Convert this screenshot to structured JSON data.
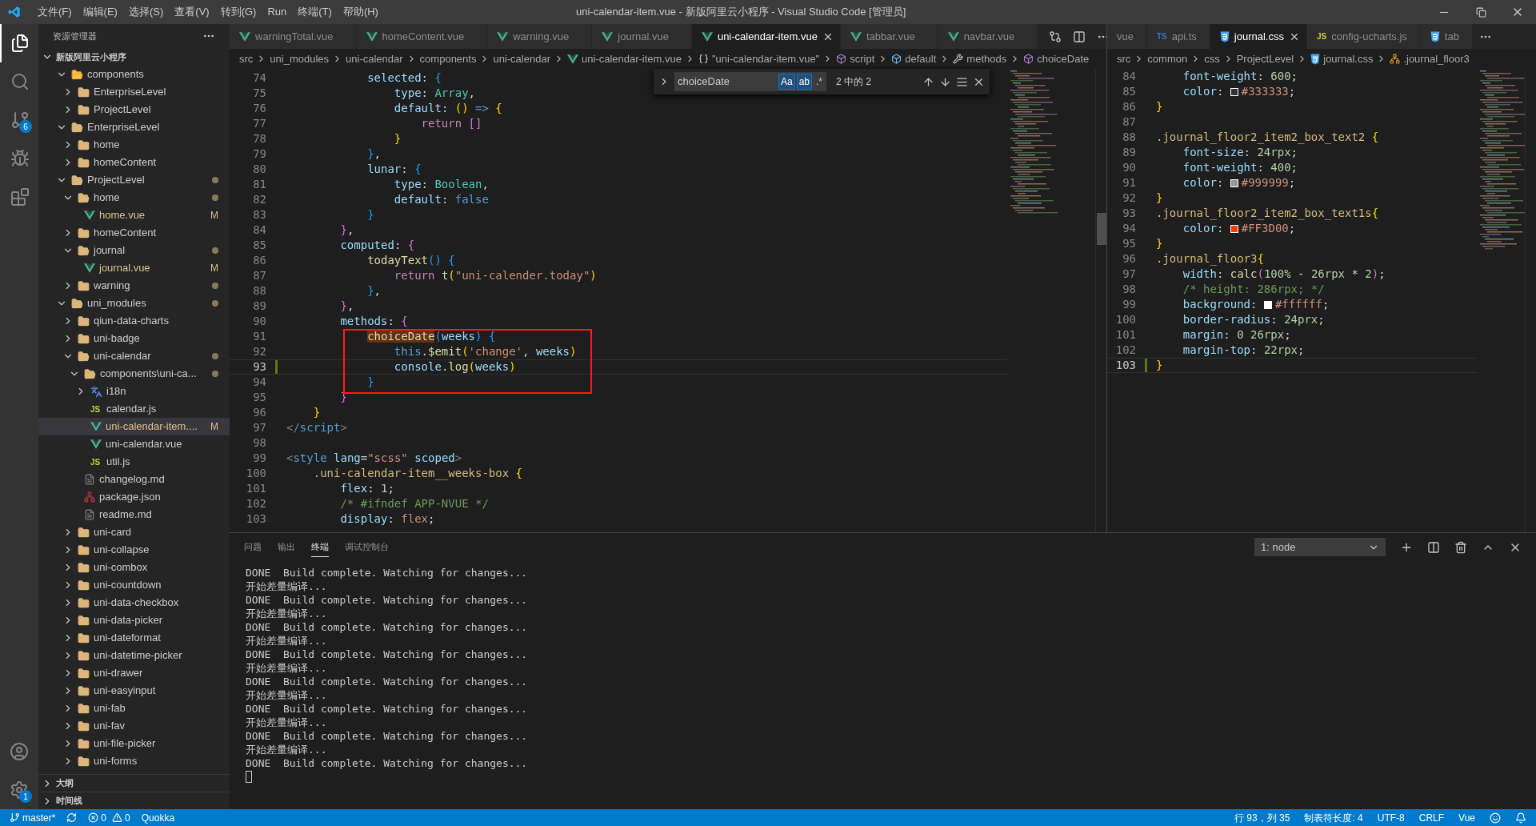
{
  "title_bar": {
    "menu": [
      "文件(F)",
      "编辑(E)",
      "选择(S)",
      "查看(V)",
      "转到(G)",
      "Run",
      "终端(T)",
      "帮助(H)"
    ],
    "title": "uni-calendar-item.vue - 新版阿里云小程序 - Visual Studio Code [管理员]"
  },
  "activity_bar": {
    "items": [
      {
        "kind": "explorer",
        "selected": true
      },
      {
        "kind": "search",
        "selected": false
      },
      {
        "kind": "scm",
        "selected": false,
        "badge": "6"
      },
      {
        "kind": "debug",
        "selected": false
      },
      {
        "kind": "extensions",
        "selected": false
      }
    ],
    "bottom": [
      {
        "kind": "account"
      },
      {
        "kind": "settings",
        "badge": "1"
      }
    ]
  },
  "sidebar": {
    "title": "资源管理器",
    "root": {
      "label": "新版阿里云小程序",
      "expanded": true,
      "children": [
        {
          "label": "components",
          "kind": "folder-special",
          "expanded": true,
          "selected": false,
          "dot": false,
          "children": [
            {
              "label": "EnterpriseLevel",
              "kind": "folder",
              "expanded": false,
              "selected": false,
              "dot": false
            },
            {
              "label": "ProjectLevel",
              "kind": "folder",
              "expanded": false,
              "selected": false,
              "dot": false
            }
          ]
        },
        {
          "label": "EnterpriseLevel",
          "kind": "folder",
          "expanded": true,
          "selected": false,
          "dot": false,
          "children": [
            {
              "label": "home",
              "kind": "folder",
              "expanded": false,
              "selected": false,
              "dot": false
            },
            {
              "label": "homeContent",
              "kind": "folder",
              "expanded": false,
              "selected": false,
              "dot": false
            }
          ]
        },
        {
          "label": "ProjectLevel",
          "kind": "folder",
          "expanded": true,
          "selected": false,
          "dot": true,
          "children": [
            {
              "label": "home",
              "kind": "folder",
              "expanded": true,
              "selected": false,
              "dot": true,
              "children": [
                {
                  "label": "home.vue",
                  "kind": "vue",
                  "selected": false,
                  "dot": false,
                  "badge": "M"
                }
              ]
            },
            {
              "label": "homeContent",
              "kind": "folder",
              "expanded": false,
              "selected": false,
              "dot": false
            },
            {
              "label": "journal",
              "kind": "folder",
              "expanded": true,
              "selected": false,
              "dot": true,
              "children": [
                {
                  "label": "journal.vue",
                  "kind": "vue",
                  "selected": false,
                  "dot": false,
                  "badge": "M"
                }
              ]
            },
            {
              "label": "warning",
              "kind": "folder",
              "expanded": false,
              "selected": false,
              "dot": true
            }
          ]
        },
        {
          "label": "uni_modules",
          "kind": "folder",
          "expanded": true,
          "selected": false,
          "dot": true,
          "children": [
            {
              "label": "qiun-data-charts",
              "kind": "folder",
              "expanded": false,
              "selected": false,
              "dot": false
            },
            {
              "label": "uni-badge",
              "kind": "folder",
              "expanded": false,
              "selected": false,
              "dot": false
            },
            {
              "label": "uni-calendar",
              "kind": "folder",
              "expanded": true,
              "selected": false,
              "dot": true,
              "children": [
                {
                  "label": "components\\uni-ca...",
                  "kind": "folder",
                  "expanded": true,
                  "selected": false,
                  "dot": true,
                  "children": [
                    {
                      "label": "i18n",
                      "kind": "folder-i18n",
                      "expanded": false,
                      "selected": false,
                      "dot": false
                    },
                    {
                      "label": "calendar.js",
                      "kind": "js",
                      "badge_icon": "JS",
                      "selected": false,
                      "dot": false
                    },
                    {
                      "label": "uni-calendar-item....",
                      "kind": "vue",
                      "selected": true,
                      "dot": false,
                      "badge": "M"
                    },
                    {
                      "label": "uni-calendar.vue",
                      "kind": "vue",
                      "selected": false,
                      "dot": false
                    },
                    {
                      "label": "util.js",
                      "kind": "js",
                      "badge_icon": "JS",
                      "selected": false,
                      "dot": false
                    }
                  ]
                },
                {
                  "label": "changelog.md",
                  "kind": "md",
                  "selected": false,
                  "dot": false
                },
                {
                  "label": "package.json",
                  "kind": "json",
                  "selected": false,
                  "dot": false
                },
                {
                  "label": "readme.md",
                  "kind": "md",
                  "selected": false,
                  "dot": false
                }
              ]
            },
            {
              "label": "uni-card",
              "kind": "folder",
              "expanded": false,
              "selected": false,
              "dot": false
            },
            {
              "label": "uni-collapse",
              "kind": "folder",
              "expanded": false,
              "selected": false,
              "dot": false
            },
            {
              "label": "uni-combox",
              "kind": "folder",
              "expanded": false,
              "selected": false,
              "dot": false
            },
            {
              "label": "uni-countdown",
              "kind": "folder",
              "expanded": false,
              "selected": false,
              "dot": false
            },
            {
              "label": "uni-data-checkbox",
              "kind": "folder",
              "expanded": false,
              "selected": false,
              "dot": false
            },
            {
              "label": "uni-data-picker",
              "kind": "folder",
              "expanded": false,
              "selected": false,
              "dot": false
            },
            {
              "label": "uni-dateformat",
              "kind": "folder",
              "expanded": false,
              "selected": false,
              "dot": false
            },
            {
              "label": "uni-datetime-picker",
              "kind": "folder",
              "expanded": false,
              "selected": false,
              "dot": false
            },
            {
              "label": "uni-drawer",
              "kind": "folder",
              "expanded": false,
              "selected": false,
              "dot": false
            },
            {
              "label": "uni-easyinput",
              "kind": "folder",
              "expanded": false,
              "selected": false,
              "dot": false
            },
            {
              "label": "uni-fab",
              "kind": "folder",
              "expanded": false,
              "selected": false,
              "dot": false
            },
            {
              "label": "uni-fav",
              "kind": "folder",
              "expanded": false,
              "selected": false,
              "dot": false
            },
            {
              "label": "uni-file-picker",
              "kind": "folder",
              "expanded": false,
              "selected": false,
              "dot": false
            },
            {
              "label": "uni-forms",
              "kind": "folder",
              "expanded": false,
              "selected": false,
              "dot": false
            }
          ]
        }
      ]
    },
    "sections": [
      {
        "label": "大纲",
        "expanded": false
      },
      {
        "label": "时间线",
        "expanded": false
      }
    ]
  },
  "left_editor": {
    "tabs": [
      {
        "label": "warningTotal.vue",
        "kind": "vue",
        "selected": false
      },
      {
        "label": "homeContent.vue",
        "kind": "vue",
        "selected": false
      },
      {
        "label": "warning.vue",
        "kind": "vue",
        "selected": false
      },
      {
        "label": "journal.vue",
        "kind": "vue",
        "selected": false
      },
      {
        "label": "uni-calendar-item.vue",
        "kind": "vue",
        "selected": true
      },
      {
        "label": "tabbar.vue",
        "kind": "vue",
        "selected": false
      },
      {
        "label": "navbar.vue",
        "kind": "vue",
        "selected": false
      }
    ],
    "breadcrumbs": [
      {
        "label": "src",
        "kind": "folder"
      },
      {
        "label": "uni_modules",
        "kind": "folder"
      },
      {
        "label": "uni-calendar",
        "kind": "folder"
      },
      {
        "label": "components",
        "kind": "folder"
      },
      {
        "label": "uni-calendar",
        "kind": "folder"
      },
      {
        "label": "uni-calendar-item.vue",
        "kind": "vue"
      },
      {
        "label": "\"uni-calendar-item.vue\"",
        "kind": "braces"
      },
      {
        "label": "script",
        "kind": "element"
      },
      {
        "label": "default",
        "kind": "field"
      },
      {
        "label": "methods",
        "kind": "wrench"
      },
      {
        "label": "choiceDate",
        "kind": "method"
      }
    ],
    "find": {
      "value": "choiceDate",
      "options": [
        {
          "label": "Aa",
          "on": true
        },
        {
          "label": "ab",
          "on": true
        },
        {
          "label": ".*",
          "on": false
        }
      ],
      "count": "2 中的 2"
    },
    "lines": [
      {
        "number": "74",
        "current": false,
        "tokens": [
          {
            "kind": "prop",
            "text": "            selected"
          },
          {
            "kind": "punc",
            "text": ": "
          },
          {
            "kind": "b3",
            "text": "{"
          }
        ]
      },
      {
        "number": "75",
        "current": false,
        "tokens": [
          {
            "kind": "prop",
            "text": "                type"
          },
          {
            "kind": "punc",
            "text": ": "
          },
          {
            "kind": "type",
            "text": "Array"
          },
          {
            "kind": "punc",
            "text": ","
          }
        ]
      },
      {
        "number": "76",
        "current": false,
        "tokens": [
          {
            "kind": "prop",
            "text": "                default"
          },
          {
            "kind": "punc",
            "text": ": "
          },
          {
            "kind": "b1",
            "text": "()"
          },
          {
            "kind": "kw",
            "text": " =>"
          },
          {
            "kind": "b1",
            "text": " {"
          }
        ]
      },
      {
        "number": "77",
        "current": false,
        "tokens": [
          {
            "kind": "ctrl",
            "text": "                    return"
          },
          {
            "kind": "b2",
            "text": " []"
          }
        ]
      },
      {
        "number": "78",
        "current": false,
        "tokens": [
          {
            "kind": "b1",
            "text": "                }"
          }
        ]
      },
      {
        "number": "79",
        "current": false,
        "tokens": [
          {
            "kind": "b3",
            "text": "            }"
          },
          {
            "kind": "punc",
            "text": ","
          }
        ]
      },
      {
        "number": "80",
        "current": false,
        "tokens": [
          {
            "kind": "prop",
            "text": "            lunar"
          },
          {
            "kind": "punc",
            "text": ": "
          },
          {
            "kind": "b3",
            "text": "{"
          }
        ]
      },
      {
        "number": "81",
        "current": false,
        "tokens": [
          {
            "kind": "prop",
            "text": "                type"
          },
          {
            "kind": "punc",
            "text": ": "
          },
          {
            "kind": "type",
            "text": "Boolean"
          },
          {
            "kind": "punc",
            "text": ","
          }
        ]
      },
      {
        "number": "82",
        "current": false,
        "tokens": [
          {
            "kind": "prop",
            "text": "                default"
          },
          {
            "kind": "punc",
            "text": ": "
          },
          {
            "kind": "kw",
            "text": "false"
          }
        ]
      },
      {
        "number": "83",
        "current": false,
        "tokens": [
          {
            "kind": "b3",
            "text": "            }"
          }
        ]
      },
      {
        "number": "84",
        "current": false,
        "tokens": [
          {
            "kind": "b2",
            "text": "        }"
          },
          {
            "kind": "punc",
            "text": ","
          }
        ]
      },
      {
        "number": "85",
        "current": false,
        "tokens": [
          {
            "kind": "prop",
            "text": "        computed"
          },
          {
            "kind": "punc",
            "text": ": "
          },
          {
            "kind": "b2",
            "text": "{"
          }
        ]
      },
      {
        "number": "86",
        "current": false,
        "tokens": [
          {
            "kind": "fn",
            "text": "            todayText"
          },
          {
            "kind": "b3",
            "text": "()"
          },
          {
            "kind": "b3",
            "text": " {"
          }
        ]
      },
      {
        "number": "87",
        "current": false,
        "tokens": [
          {
            "kind": "ctrl",
            "text": "                return"
          },
          {
            "kind": "fn",
            "text": " t"
          },
          {
            "kind": "b1",
            "text": "("
          },
          {
            "kind": "str",
            "text": "\"uni-calender.today\""
          },
          {
            "kind": "b1",
            "text": ")"
          }
        ]
      },
      {
        "number": "88",
        "current": false,
        "tokens": [
          {
            "kind": "b3",
            "text": "            }"
          },
          {
            "kind": "punc",
            "text": ","
          }
        ]
      },
      {
        "number": "89",
        "current": false,
        "tokens": [
          {
            "kind": "b2",
            "text": "        }"
          },
          {
            "kind": "punc",
            "text": ","
          }
        ]
      },
      {
        "number": "90",
        "current": false,
        "tokens": [
          {
            "kind": "prop",
            "text": "        methods"
          },
          {
            "kind": "punc",
            "text": ": "
          },
          {
            "kind": "b2",
            "text": "{"
          }
        ]
      },
      {
        "number": "91",
        "current": false,
        "tokens": [
          {
            "kind": "match",
            "text": "            choiceDate"
          },
          {
            "kind": "b3",
            "text": "("
          },
          {
            "kind": "var",
            "text": "weeks"
          },
          {
            "kind": "b3",
            "text": ")"
          },
          {
            "kind": "b3",
            "text": " {"
          }
        ]
      },
      {
        "number": "92",
        "current": false,
        "tokens": [
          {
            "kind": "kw",
            "text": "                this"
          },
          {
            "kind": "fn",
            "text": ".$emit"
          },
          {
            "kind": "b1",
            "text": "("
          },
          {
            "kind": "str",
            "text": "'change'"
          },
          {
            "kind": "punc",
            "text": ", "
          },
          {
            "kind": "var",
            "text": "weeks"
          },
          {
            "kind": "b1",
            "text": ")"
          }
        ]
      },
      {
        "number": "93",
        "current": true,
        "tokens": [
          {
            "kind": "var",
            "text": "                console"
          },
          {
            "kind": "punc",
            "text": "."
          },
          {
            "kind": "fn",
            "text": "log"
          },
          {
            "kind": "b1",
            "text": "("
          },
          {
            "kind": "var",
            "text": "weeks"
          },
          {
            "kind": "b1",
            "text": ")"
          }
        ]
      },
      {
        "number": "94",
        "current": false,
        "tokens": [
          {
            "kind": "b3",
            "text": "            }"
          }
        ]
      },
      {
        "number": "95",
        "current": false,
        "tokens": [
          {
            "kind": "b2",
            "text": "        }"
          }
        ]
      },
      {
        "number": "96",
        "current": false,
        "tokens": [
          {
            "kind": "b1",
            "text": "    }"
          }
        ]
      },
      {
        "number": "97",
        "current": false,
        "tokens": [
          {
            "kind": "tag",
            "text": "</"
          },
          {
            "kind": "tagname",
            "text": "script"
          },
          {
            "kind": "tag",
            "text": ">"
          }
        ]
      },
      {
        "number": "98",
        "current": false
      },
      {
        "number": "99",
        "current": false,
        "tokens": [
          {
            "kind": "tag",
            "text": "<"
          },
          {
            "kind": "tagname",
            "text": "style"
          },
          {
            "kind": "prop",
            "text": " lang"
          },
          {
            "kind": "punc",
            "text": "="
          },
          {
            "kind": "str",
            "text": "\"scss\""
          },
          {
            "kind": "prop",
            "text": " scoped"
          },
          {
            "kind": "tag",
            "text": ">"
          }
        ]
      },
      {
        "number": "100",
        "current": false,
        "tokens": [
          {
            "kind": "sel",
            "text": "    .uni-calendar-item__weeks-box"
          },
          {
            "kind": "b1",
            "text": " {"
          }
        ]
      },
      {
        "number": "101",
        "current": false,
        "tokens": [
          {
            "kind": "prop",
            "text": "        flex"
          },
          {
            "kind": "punc",
            "text": ": "
          },
          {
            "kind": "num",
            "text": "1"
          },
          {
            "kind": "punc",
            "text": ";"
          }
        ]
      },
      {
        "number": "102",
        "current": false,
        "tokens": [
          {
            "kind": "comment",
            "text": "        /* #ifndef APP-NVUE */"
          }
        ]
      },
      {
        "number": "103",
        "current": false,
        "tokens": [
          {
            "kind": "prop",
            "text": "        display"
          },
          {
            "kind": "punc",
            "text": ": "
          },
          {
            "kind": "str",
            "text": "flex"
          },
          {
            "kind": "punc",
            "text": ";"
          }
        ]
      }
    ]
  },
  "right_editor": {
    "tabs": [
      {
        "label": "vue",
        "kind": "plain",
        "selected": false
      },
      {
        "label": "api.ts",
        "kind": "ts",
        "badge": "TS",
        "selected": false
      },
      {
        "label": "journal.css",
        "kind": "css",
        "selected": true
      },
      {
        "label": "config-ucharts.js",
        "kind": "js",
        "badge": "JS",
        "selected": false
      },
      {
        "label": "tab",
        "kind": "css",
        "selected": false
      }
    ],
    "breadcrumbs": [
      {
        "label": "src",
        "kind": "folder"
      },
      {
        "label": "common",
        "kind": "folder"
      },
      {
        "label": "css",
        "kind": "folder"
      },
      {
        "label": "ProjectLevel",
        "kind": "folder"
      },
      {
        "label": "journal.css",
        "kind": "css"
      },
      {
        "label": ".journal_floor3",
        "kind": "class"
      }
    ],
    "lines": [
      {
        "number": "84",
        "current": false,
        "tokens": [
          {
            "kind": "prop",
            "text": "    font-weight"
          },
          {
            "kind": "punc",
            "text": ": "
          },
          {
            "kind": "num",
            "text": "600"
          },
          {
            "kind": "punc",
            "text": ";"
          }
        ]
      },
      {
        "number": "85",
        "current": false,
        "tokens": [
          {
            "kind": "prop",
            "text": "    color"
          },
          {
            "kind": "punc",
            "text": ": "
          },
          {
            "kind": "colorval",
            "text": "#333333",
            "color": "#333333"
          },
          {
            "kind": "punc",
            "text": ";"
          }
        ]
      },
      {
        "number": "86",
        "current": false,
        "tokens": [
          {
            "kind": "b1",
            "text": "}"
          }
        ]
      },
      {
        "number": "87",
        "current": false
      },
      {
        "number": "88",
        "current": false,
        "tokens": [
          {
            "kind": "sel",
            "text": ".journal_floor2_item2_box_text2"
          },
          {
            "kind": "b1",
            "text": " {"
          }
        ]
      },
      {
        "number": "89",
        "current": false,
        "tokens": [
          {
            "kind": "prop",
            "text": "    font-size"
          },
          {
            "kind": "punc",
            "text": ": "
          },
          {
            "kind": "num",
            "text": "24rpx"
          },
          {
            "kind": "punc",
            "text": ";"
          }
        ]
      },
      {
        "number": "90",
        "current": false,
        "tokens": [
          {
            "kind": "prop",
            "text": "    font-weight"
          },
          {
            "kind": "punc",
            "text": ": "
          },
          {
            "kind": "num",
            "text": "400"
          },
          {
            "kind": "punc",
            "text": ";"
          }
        ]
      },
      {
        "number": "91",
        "current": false,
        "tokens": [
          {
            "kind": "prop",
            "text": "    color"
          },
          {
            "kind": "punc",
            "text": ": "
          },
          {
            "kind": "colorval",
            "text": "#999999",
            "color": "#999999"
          },
          {
            "kind": "punc",
            "text": ";"
          }
        ]
      },
      {
        "number": "92",
        "current": false,
        "tokens": [
          {
            "kind": "b1",
            "text": "}"
          }
        ]
      },
      {
        "number": "93",
        "current": false,
        "tokens": [
          {
            "kind": "sel",
            "text": ".journal_floor2_item2_box_text1s"
          },
          {
            "kind": "b1",
            "text": "{"
          }
        ]
      },
      {
        "number": "94",
        "current": false,
        "tokens": [
          {
            "kind": "prop",
            "text": "    color"
          },
          {
            "kind": "punc",
            "text": ": "
          },
          {
            "kind": "colorval",
            "text": "#FF3D00",
            "color": "#ff3d00"
          },
          {
            "kind": "punc",
            "text": ";"
          }
        ]
      },
      {
        "number": "95",
        "current": false,
        "tokens": [
          {
            "kind": "b1",
            "text": "}"
          }
        ]
      },
      {
        "number": "96",
        "current": false,
        "tokens": [
          {
            "kind": "sel",
            "text": ".journal_floor3"
          },
          {
            "kind": "b1",
            "text": "{"
          }
        ]
      },
      {
        "number": "97",
        "current": false,
        "tokens": [
          {
            "kind": "prop",
            "text": "    width"
          },
          {
            "kind": "punc",
            "text": ": "
          },
          {
            "kind": "fn",
            "text": "calc"
          },
          {
            "kind": "b2",
            "text": "("
          },
          {
            "kind": "num",
            "text": "100%"
          },
          {
            "kind": "punc",
            "text": " - "
          },
          {
            "kind": "num",
            "text": "26rpx"
          },
          {
            "kind": "punc",
            "text": " * "
          },
          {
            "kind": "num",
            "text": "2"
          },
          {
            "kind": "b2",
            "text": ")"
          },
          {
            "kind": "punc",
            "text": ";"
          }
        ]
      },
      {
        "number": "98",
        "current": false,
        "tokens": [
          {
            "kind": "comment",
            "text": "    /* height: 286rpx; */"
          }
        ]
      },
      {
        "number": "99",
        "current": false,
        "tokens": [
          {
            "kind": "prop",
            "text": "    background"
          },
          {
            "kind": "punc",
            "text": ": "
          },
          {
            "kind": "colorval",
            "text": "#ffffff",
            "color": "#ffffff"
          },
          {
            "kind": "punc",
            "text": ";"
          }
        ]
      },
      {
        "number": "100",
        "current": false,
        "tokens": [
          {
            "kind": "prop",
            "text": "    border-radius"
          },
          {
            "kind": "punc",
            "text": ": "
          },
          {
            "kind": "num",
            "text": "24prx"
          },
          {
            "kind": "punc",
            "text": ";"
          }
        ]
      },
      {
        "number": "101",
        "current": false,
        "tokens": [
          {
            "kind": "prop",
            "text": "    margin"
          },
          {
            "kind": "punc",
            "text": ": "
          },
          {
            "kind": "num",
            "text": "0 26rpx"
          },
          {
            "kind": "punc",
            "text": ";"
          }
        ]
      },
      {
        "number": "102",
        "current": false,
        "tokens": [
          {
            "kind": "prop",
            "text": "    margin-top"
          },
          {
            "kind": "punc",
            "text": ": "
          },
          {
            "kind": "num",
            "text": "22rpx"
          },
          {
            "kind": "punc",
            "text": ";"
          }
        ]
      },
      {
        "number": "103",
        "current": true,
        "tokens": [
          {
            "kind": "b1",
            "text": "}"
          }
        ]
      }
    ]
  },
  "panel": {
    "tabs": [
      {
        "label": "问题",
        "selected": false
      },
      {
        "label": "输出",
        "selected": false
      },
      {
        "label": "终端",
        "selected": true
      },
      {
        "label": "调试控制台",
        "selected": false
      }
    ],
    "terminal_select": "1: node",
    "lines": [
      "DONE  Build complete. Watching for changes...",
      "开始差量编译...",
      "DONE  Build complete. Watching for changes...",
      "开始差量编译...",
      "DONE  Build complete. Watching for changes...",
      "开始差量编译...",
      "DONE  Build complete. Watching for changes...",
      "开始差量编译...",
      "DONE  Build complete. Watching for changes...",
      "开始差量编译...",
      "DONE  Build complete. Watching for changes...",
      "开始差量编译...",
      "DONE  Build complete. Watching for changes...",
      "开始差量编译...",
      "DONE  Build complete. Watching for changes..."
    ]
  },
  "status_bar": {
    "branch": "master*",
    "errors": "0",
    "warnings": "0",
    "left_items": [
      "Quokka"
    ],
    "right_items": [
      "行 93，列 35",
      "制表符长度: 4",
      "UTF-8",
      "CRLF",
      "Vue"
    ]
  }
}
